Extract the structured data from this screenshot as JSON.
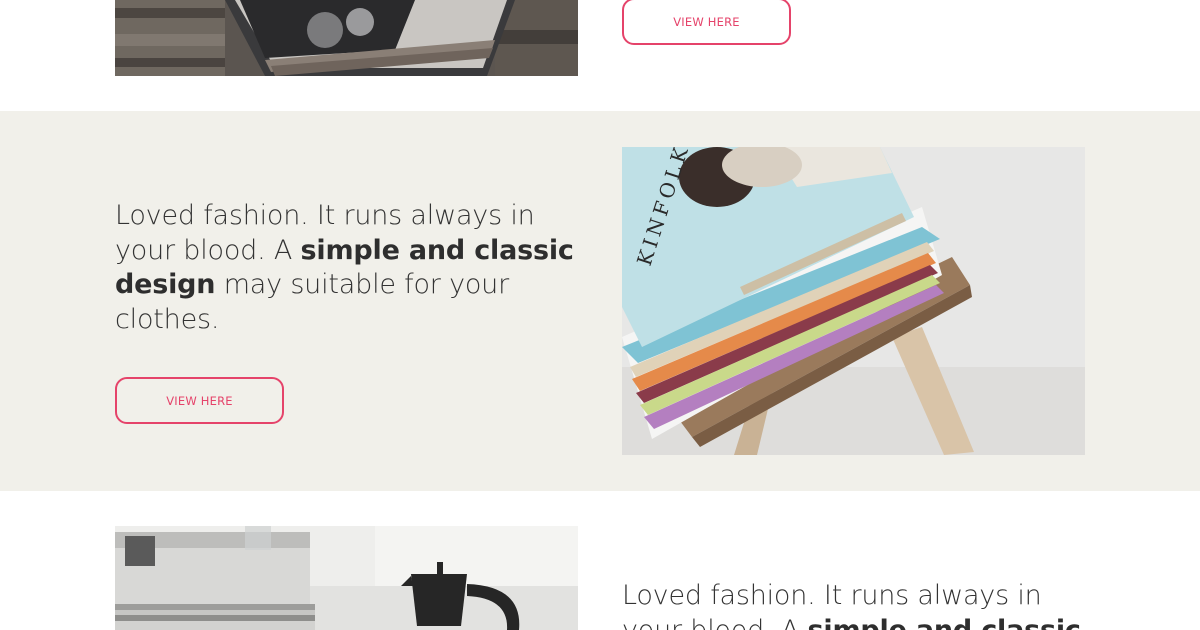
{
  "colors": {
    "accent": "#e5436a",
    "alt_section_bg": "#f1f0ea",
    "text": "#333333"
  },
  "sections": [
    {
      "id": "top",
      "image": "magazine-stack-on-wooden-crate-photo",
      "button_label": "VIEW HERE"
    },
    {
      "id": "middle",
      "blurb": {
        "before": "Loved fashion. It runs always in your blood. A ",
        "emphasis": "simple and classic design",
        "after": " may suitable for your clothes."
      },
      "button_label": "VIEW HERE",
      "image": "kinfolk-magazine-stack-on-wooden-stool-photo"
    },
    {
      "id": "bottom",
      "image": "magazines-and-moka-pot-on-white-table-photo",
      "blurb": {
        "before": "Loved fashion. It runs always in your blood. A ",
        "emphasis": "simple and classic",
        "after": ""
      }
    }
  ]
}
